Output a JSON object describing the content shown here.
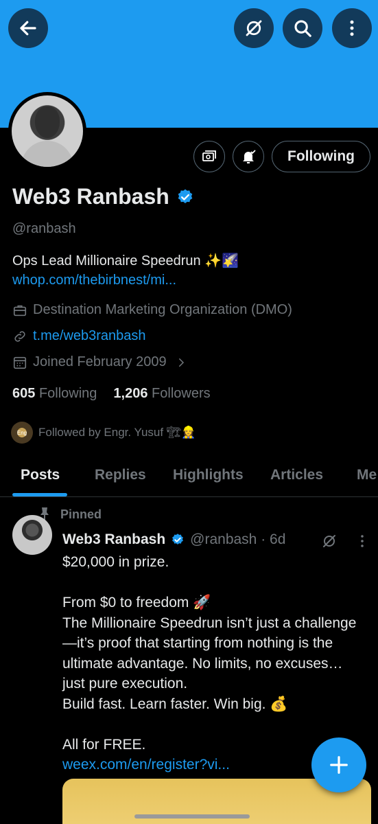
{
  "colors": {
    "banner": "#1d9bf0",
    "accent": "#1d9bf0",
    "muted": "#71767b",
    "text": "#e7e9ea"
  },
  "header": {
    "back_icon": "arrow-left-icon",
    "grok_icon": "grok-icon",
    "search_icon": "search-icon",
    "more_icon": "more-vertical-icon"
  },
  "profile": {
    "name": "Web3 Ranbash",
    "handle": "@ranbash",
    "bio_text": "Ops Lead Millionaire Speedrun ✨🌠",
    "bio_link": "whop.com/thebirbnest/mi...",
    "category": "Destination Marketing Organization (DMO)",
    "website": "t.me/web3ranbash",
    "joined": "Joined February 2009",
    "following_count": "605",
    "following_label": "Following",
    "followers_count": "1,206",
    "followers_label": "Followers",
    "followed_by": "Followed by Engr. Yusuf 🏗👷‍♀️",
    "follow_button": "Following"
  },
  "tabs": [
    {
      "label": "Posts",
      "active": true
    },
    {
      "label": "Replies",
      "active": false
    },
    {
      "label": "Highlights",
      "active": false
    },
    {
      "label": "Articles",
      "active": false
    },
    {
      "label": "Me",
      "active": false
    }
  ],
  "pinned_post": {
    "pinned_label": "Pinned",
    "author": "Web3 Ranbash",
    "handle_time": "@ranbash · 6d",
    "lines": [
      "$20,000 in prize.",
      "",
      "From $0 to freedom 🚀",
      "The Millionaire Speedrun isn’t just a challenge—it’s proof that starting from nothing is the ultimate advantage. No limits, no excuses… just pure execution.",
      "Build fast. Learn faster. Win big. 💰",
      "",
      "All for FREE."
    ],
    "link": "weex.com/en/register?vi..."
  },
  "fab_icon": "compose-plus-icon"
}
